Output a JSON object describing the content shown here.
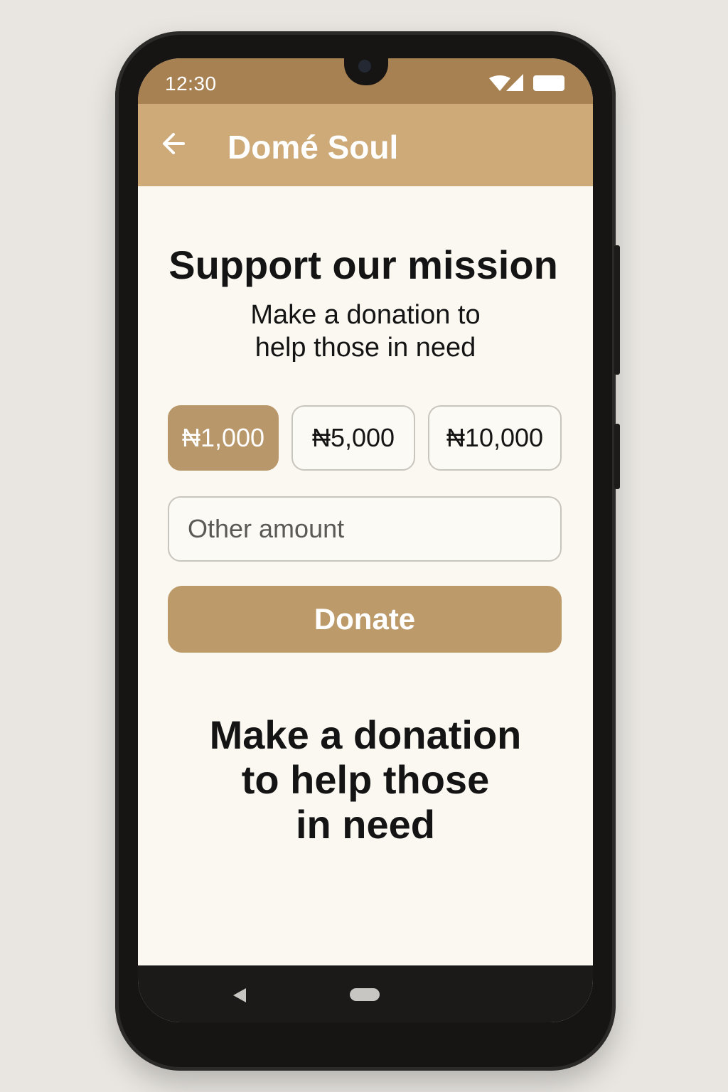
{
  "status_bar": {
    "time": "12:30",
    "wifi_icon": "wifi-icon",
    "signal_icon": "signal-icon",
    "battery_icon": "battery-icon"
  },
  "app_bar": {
    "back_icon": "arrow-left-icon",
    "title": "Domé Soul"
  },
  "main": {
    "heading": "Support our mission",
    "subheading": "Make a donation to help those in need",
    "amounts": [
      {
        "label": "₦1,000",
        "selected": true
      },
      {
        "label": "₦5,000",
        "selected": false
      },
      {
        "label": "₦10,000",
        "selected": false
      }
    ],
    "other_amount_placeholder": "Other amount",
    "donate_label": "Donate",
    "footer_text": "Make a donation\nto help those\nin need"
  },
  "nav_bar": {
    "back_icon": "triangle-back-icon",
    "home_icon": "home-pill-icon"
  },
  "colors": {
    "header": "#cdaa78",
    "status_bar": "#a88152",
    "accent": "#bc9a69",
    "background": "#fbf8f1"
  }
}
